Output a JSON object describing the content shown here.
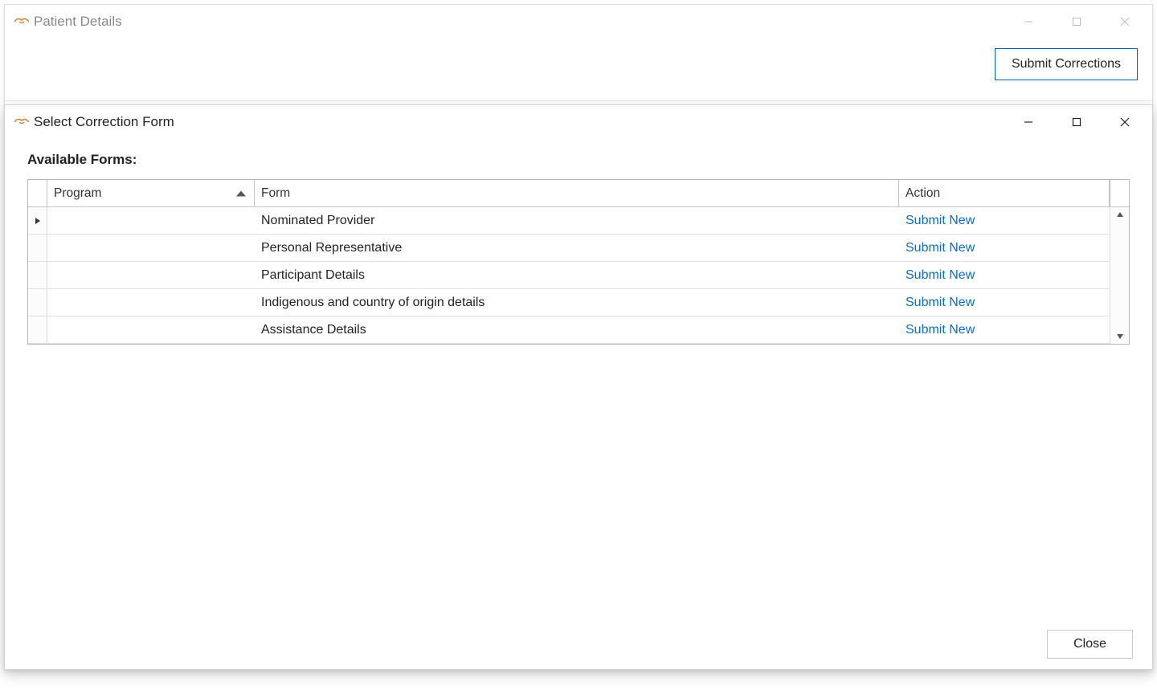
{
  "outer_window": {
    "title": "Patient Details",
    "submit_button": "Submit Corrections"
  },
  "modal": {
    "title": "Select Correction Form",
    "section_label": "Available Forms:",
    "close_button": "Close",
    "columns": {
      "program": "Program",
      "form": "Form",
      "action": "Action"
    },
    "action_link_label": "Submit New",
    "rows": [
      {
        "program": "",
        "form": "Nominated Provider"
      },
      {
        "program": "",
        "form": "Personal Representative"
      },
      {
        "program": "",
        "form": "Participant Details"
      },
      {
        "program": "",
        "form": "Indigenous and country of origin details"
      },
      {
        "program": "",
        "form": "Assistance Details"
      }
    ]
  }
}
